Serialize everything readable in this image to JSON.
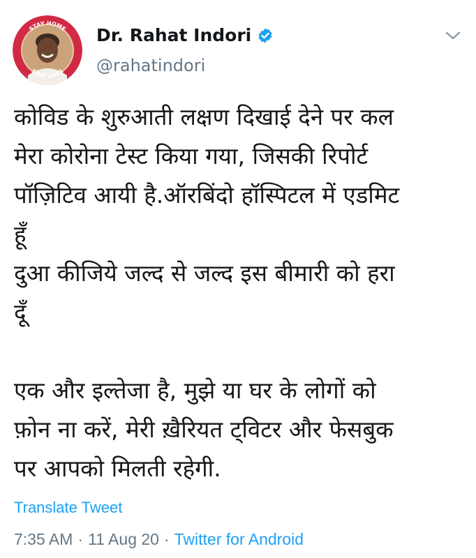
{
  "author": {
    "display_name": "Dr. Rahat Indori",
    "handle": "@rahatindori",
    "verified_icon": "verified-badge-icon",
    "avatar_badge_top": "STAY HOME",
    "avatar_badge_bottom": "SAVE LIVES"
  },
  "tweet": {
    "text": "कोविड के शुरुआती लक्षण दिखाई देने पर कल\nमेरा कोरोना टेस्ट किया गया, जिसकी रिपोर्ट\nपॉज़िटिव आयी है.ऑरबिंदो हॉस्पिटल में एडमिट\nहूँ\nदुआ कीजिये जल्द से जल्द इस बीमारी को हरा\nदूँ\n\nएक और इल्तेजा है, मुझे या घर के लोगों को\nफ़ोन ना करें, मेरी ख़ैरियत ट्विटर और फेसबुक\nपर आपको मिलती रहेगी.",
    "translate_label": "Translate Tweet",
    "time": "7:35 AM",
    "date": "11 Aug 20",
    "separator": "·",
    "source": "Twitter for Android"
  },
  "colors": {
    "link": "#1da1f2",
    "secondary": "#657786",
    "primary_text": "#14171a",
    "avatar_ring": "#d12a45"
  }
}
